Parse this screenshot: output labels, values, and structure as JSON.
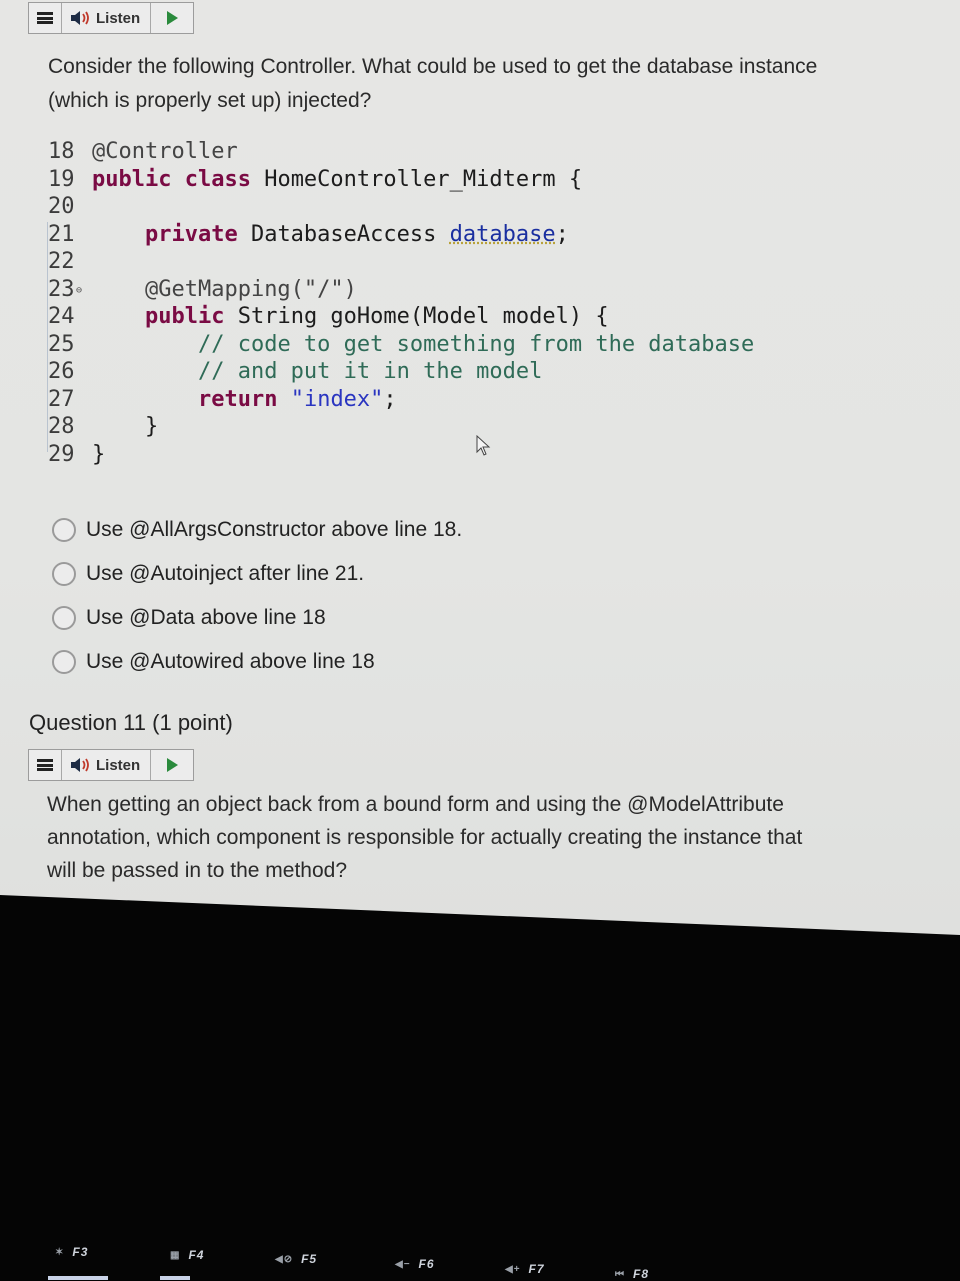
{
  "top_listen_bar": {
    "menu_icon": "hamburger-icon",
    "speaker_icon": "speaker-icon",
    "label": "Listen",
    "play_icon": "play-icon"
  },
  "question_10": {
    "prompt_line1": "Consider the following Controller. What could be used to get the database instance",
    "prompt_line2": "(which is properly set up) injected?",
    "code_lines": [
      {
        "num": "18",
        "text": "@Controller"
      },
      {
        "num": "19",
        "kw": "public class",
        "text": " HomeController_Midterm {"
      },
      {
        "num": "20",
        "text": ""
      },
      {
        "num": "21",
        "indent": "    ",
        "kw": "private",
        "text": " DatabaseAccess ",
        "field": "database",
        "end": ";"
      },
      {
        "num": "22",
        "text": ""
      },
      {
        "num": "23",
        "fold": "⊖",
        "indent": "    ",
        "text": "@GetMapping(\"/\")"
      },
      {
        "num": "24",
        "indent": "    ",
        "kw": "public",
        "text": " String goHome(Model model) {"
      },
      {
        "num": "25",
        "indent": "        ",
        "comment": "// code to get something from the database"
      },
      {
        "num": "26",
        "indent": "        ",
        "comment": "// and put it in the model"
      },
      {
        "num": "27",
        "indent": "        ",
        "kw": "return",
        "text": " ",
        "string": "\"index\"",
        "end": ";"
      },
      {
        "num": "28",
        "indent": "    ",
        "text": "}"
      },
      {
        "num": "29",
        "text": "}"
      }
    ],
    "options": [
      {
        "label": "Use @AllArgsConstructor above line 18.",
        "selected": false
      },
      {
        "label": "Use @Autoinject after line 21.",
        "selected": false
      },
      {
        "label": "Use @Data above line 18",
        "selected": false
      },
      {
        "label": "Use @Autowired above line 18",
        "selected": false
      }
    ]
  },
  "question_11": {
    "title": "Question 11",
    "points": "(1 point)",
    "listen_label": "Listen",
    "prompt_line1": "When getting an object back from a bound form and using the @ModelAttribute",
    "prompt_line2": "annotation, which component is responsible for actually creating the instance that",
    "prompt_line3": "will be passed in to the method?"
  },
  "keyboard": {
    "keys": [
      {
        "icon": "✶",
        "label": "F3"
      },
      {
        "icon": "▦",
        "label": "F4"
      },
      {
        "icon": "◀⊘",
        "label": "F5"
      },
      {
        "icon": "◀−",
        "label": "F6"
      },
      {
        "icon": "◀+",
        "label": "F7"
      },
      {
        "icon": "⏮",
        "label": "F8"
      }
    ]
  }
}
